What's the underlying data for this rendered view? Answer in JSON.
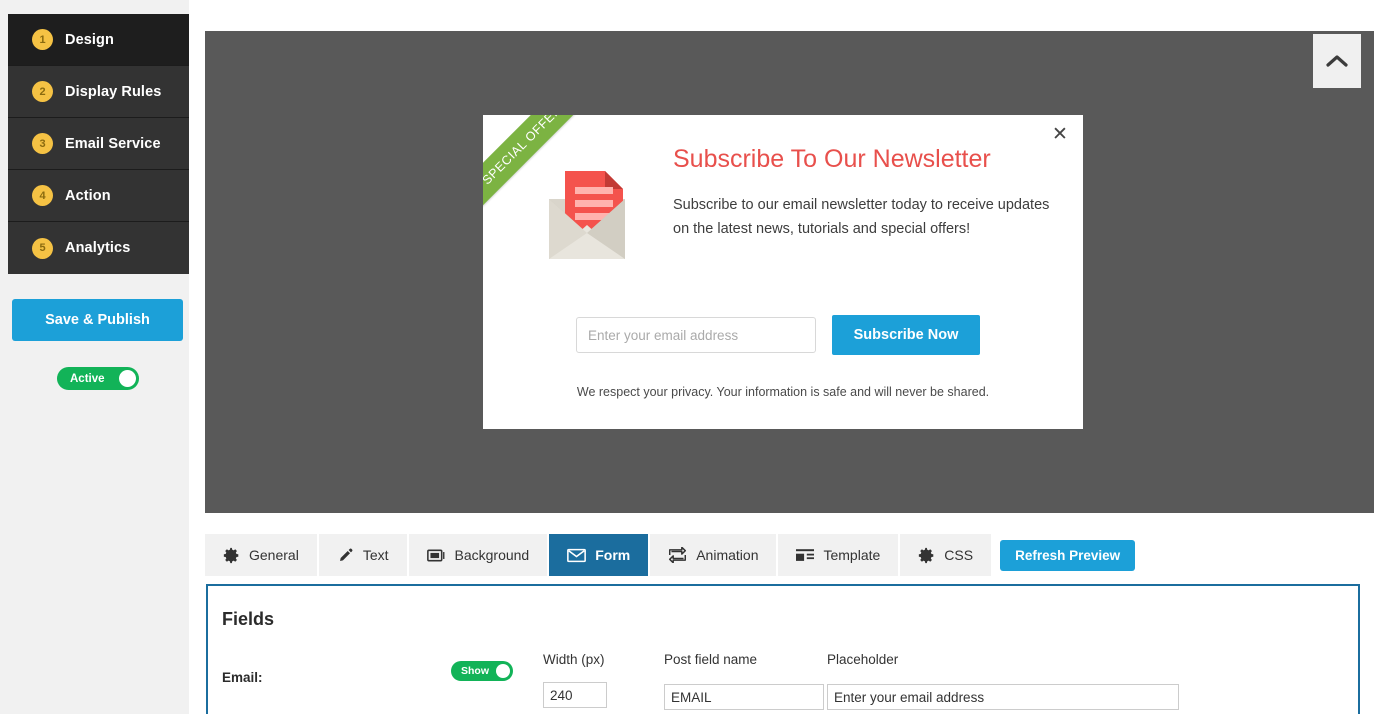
{
  "sidebar": {
    "steps": [
      {
        "num": "1",
        "label": "Design",
        "active": true
      },
      {
        "num": "2",
        "label": "Display Rules",
        "active": false
      },
      {
        "num": "3",
        "label": "Email Service",
        "active": false
      },
      {
        "num": "4",
        "label": "Action",
        "active": false
      },
      {
        "num": "5",
        "label": "Analytics",
        "active": false
      }
    ],
    "save_label": "Save & Publish",
    "status_toggle": {
      "label": "Active",
      "on": true
    }
  },
  "preview": {
    "collapse_icon": "chevron-up-icon",
    "background_color": "#595959",
    "popup": {
      "ribbon_text": "SPECIAL OFFER",
      "ribbon_color": "#7cb342",
      "close_icon": "close-icon",
      "icon": "envelope-newsletter-icon",
      "title": "Subscribe To Our Newsletter",
      "title_color": "#e8504c",
      "description": "Subscribe to our email newsletter today to receive updates on the latest news, tutorials and special offers!",
      "email_placeholder": "Enter your email address",
      "email_value": "",
      "submit_label": "Subscribe Now",
      "submit_color": "#1ca0d8",
      "privacy_text": "We respect your privacy. Your information is safe and will never be shared."
    }
  },
  "tabs": {
    "items": [
      {
        "label": "General",
        "icon": "gear-icon",
        "active": false
      },
      {
        "label": "Text",
        "icon": "pencil-icon",
        "active": false
      },
      {
        "label": "Background",
        "icon": "image-icon",
        "active": false
      },
      {
        "label": "Form",
        "icon": "envelope-icon",
        "active": true
      },
      {
        "label": "Animation",
        "icon": "animation-icon",
        "active": false
      },
      {
        "label": "Template",
        "icon": "layout-icon",
        "active": false
      },
      {
        "label": "CSS",
        "icon": "gear-icon",
        "active": false
      }
    ],
    "refresh_label": "Refresh Preview",
    "active_color": "#1b6d9e"
  },
  "fields_panel": {
    "title": "Fields",
    "columns": {
      "width": "Width (px)",
      "post_field_name": "Post field name",
      "placeholder": "Placeholder"
    },
    "rows": [
      {
        "label": "Email:",
        "show_toggle": {
          "label": "Show",
          "on": true
        },
        "width": "240",
        "post_field_name": "EMAIL",
        "placeholder_value": "Enter your email address"
      }
    ]
  }
}
